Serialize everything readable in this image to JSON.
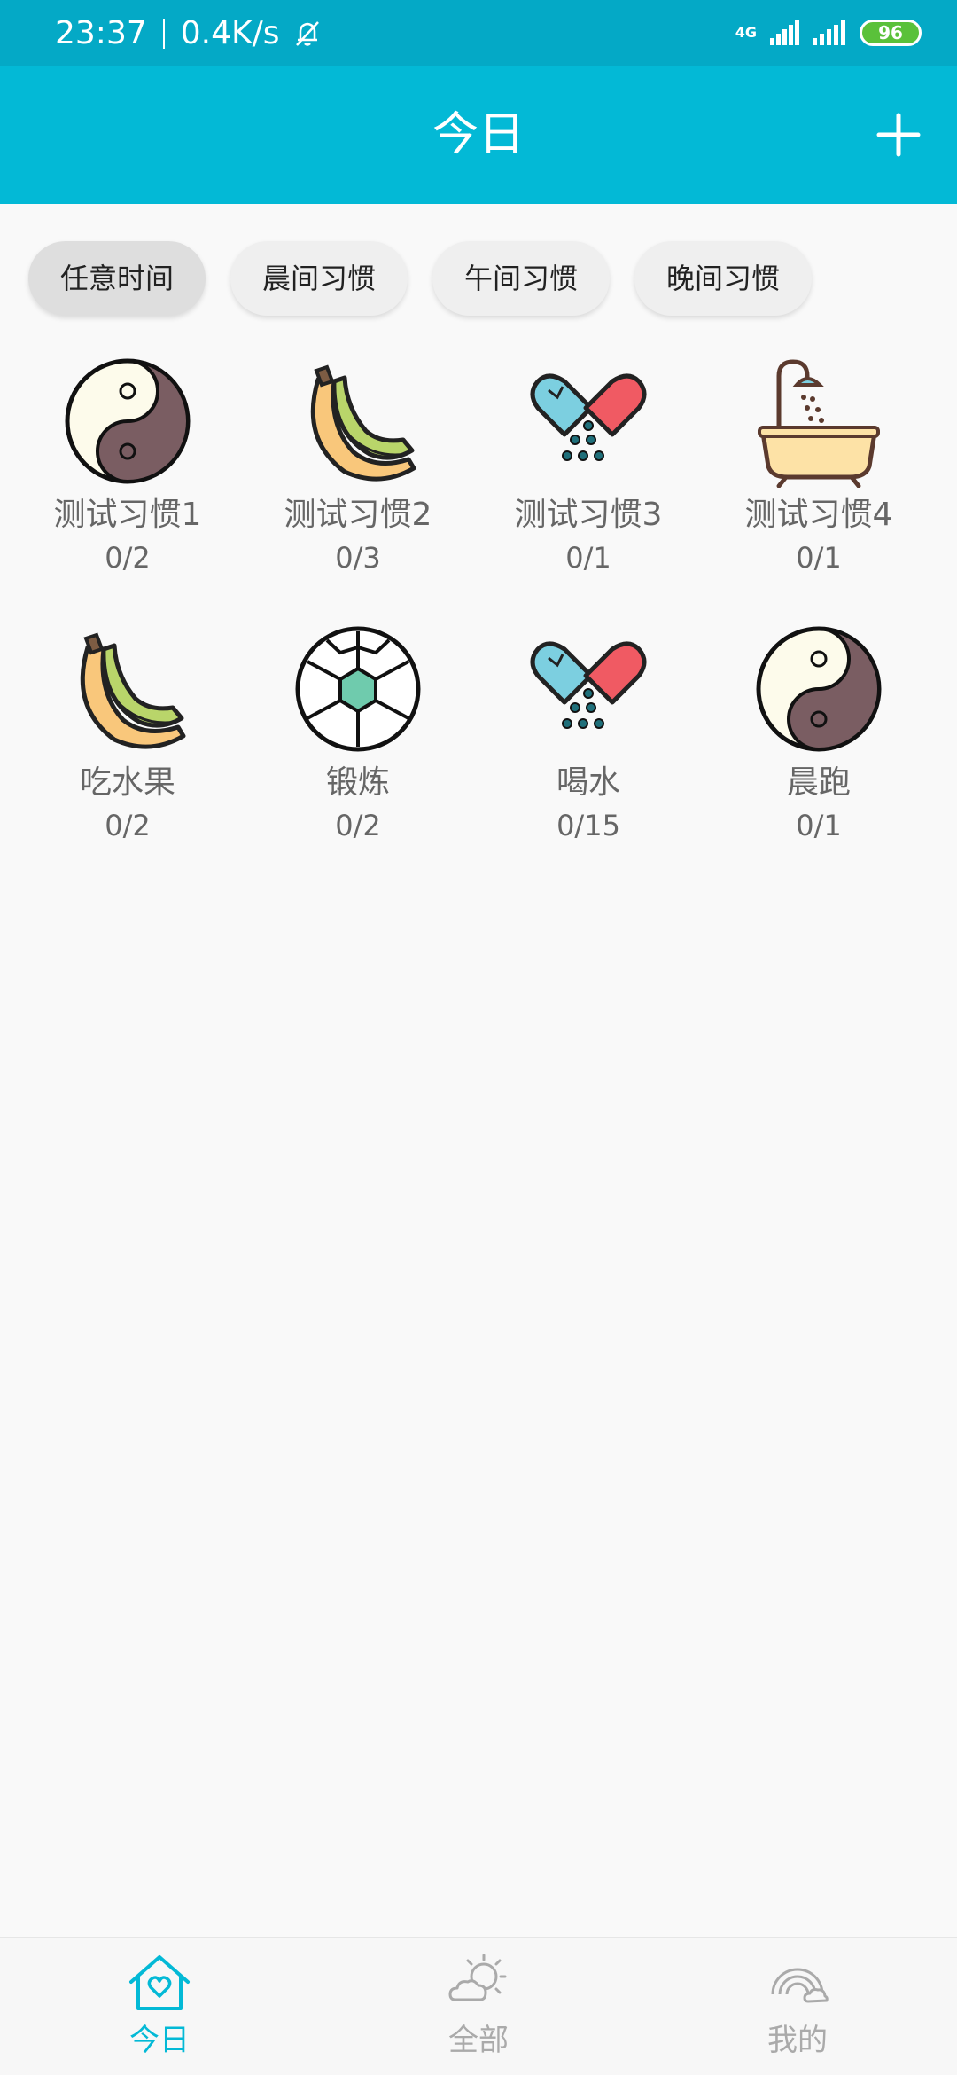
{
  "status": {
    "time": "23:37",
    "speed": "0.4K/s",
    "network": "4G",
    "battery": "96"
  },
  "header": {
    "title": "今日"
  },
  "filters": [
    {
      "label": "任意时间",
      "active": true
    },
    {
      "label": "晨间习惯",
      "active": false
    },
    {
      "label": "午间习惯",
      "active": false
    },
    {
      "label": "晚间习惯",
      "active": false
    }
  ],
  "habits": [
    {
      "name": "测试习惯1",
      "count": "0/2",
      "icon": "yin-yang-icon"
    },
    {
      "name": "测试习惯2",
      "count": "0/3",
      "icon": "banana-icon"
    },
    {
      "name": "测试习惯3",
      "count": "0/1",
      "icon": "pills-icon"
    },
    {
      "name": "测试习惯4",
      "count": "0/1",
      "icon": "bathtub-icon"
    },
    {
      "name": "吃水果",
      "count": "0/2",
      "icon": "banana-icon"
    },
    {
      "name": "锻炼",
      "count": "0/2",
      "icon": "soccer-ball-icon"
    },
    {
      "name": "喝水",
      "count": "0/15",
      "icon": "pills-icon"
    },
    {
      "name": "晨跑",
      "count": "0/1",
      "icon": "yin-yang-icon"
    }
  ],
  "nav": [
    {
      "label": "今日",
      "icon": "home-heart-icon",
      "active": true
    },
    {
      "label": "全部",
      "icon": "sun-cloud-icon",
      "active": false
    },
    {
      "label": "我的",
      "icon": "rainbow-icon",
      "active": false
    }
  ],
  "colors": {
    "primary": "#03b9d6",
    "status_bar": "#04a9c6",
    "background": "#f9f9f9"
  }
}
